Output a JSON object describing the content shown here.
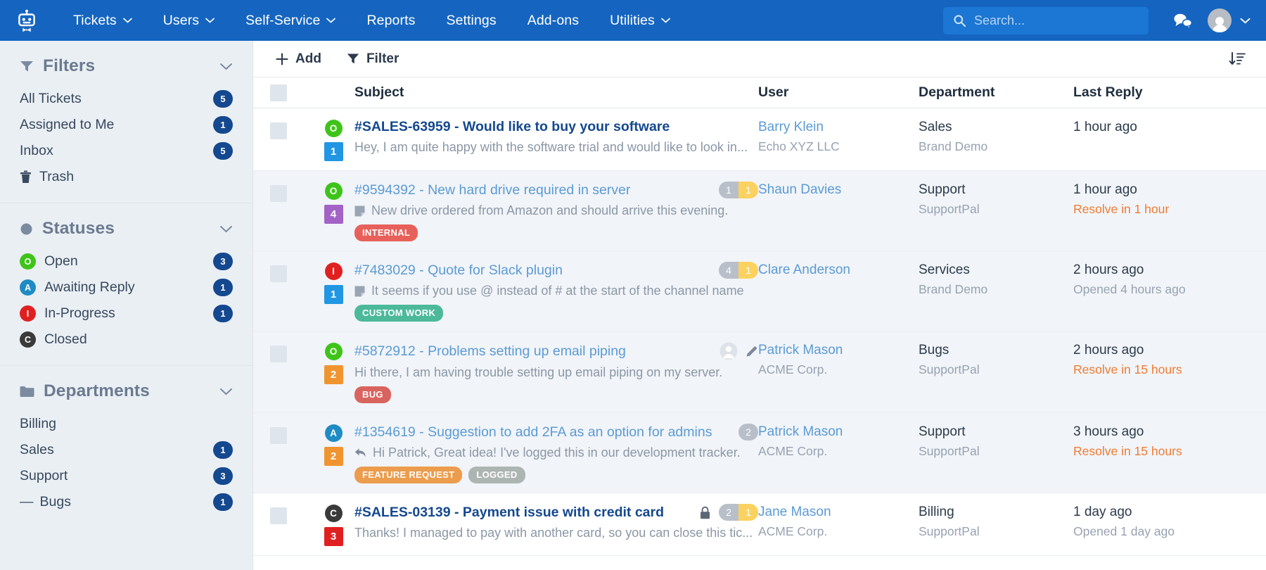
{
  "nav": {
    "logo_icon": "robot-logo-icon",
    "items": [
      {
        "label": "Tickets",
        "caret": true
      },
      {
        "label": "Users",
        "caret": true
      },
      {
        "label": "Self-Service",
        "caret": true
      },
      {
        "label": "Reports",
        "caret": false
      },
      {
        "label": "Settings",
        "caret": false
      },
      {
        "label": "Add-ons",
        "caret": false
      },
      {
        "label": "Utilities",
        "caret": true
      }
    ],
    "search": {
      "placeholder": "Search...",
      "value": "",
      "icon": "search-icon"
    },
    "chat_icon": "chat-bubbles-icon",
    "account_icon": "user-avatar-icon",
    "account_caret_icon": "chevron-down-icon"
  },
  "sidebar": {
    "sections": [
      {
        "title": "Filters",
        "icon": "funnel-icon",
        "chevron": "chevron-down-icon",
        "rows": [
          {
            "label": "All Tickets",
            "count": "5",
            "icon": "",
            "type": "plain"
          },
          {
            "label": "Assigned to Me",
            "count": "1",
            "icon": "",
            "type": "plain"
          },
          {
            "label": "Inbox",
            "count": "5",
            "icon": "",
            "type": "plain"
          },
          {
            "label": "Trash",
            "count": "",
            "icon": "trash-icon",
            "type": "icon"
          }
        ]
      },
      {
        "title": "Statuses",
        "icon": "circle-icon",
        "chevron": "chevron-down-icon",
        "rows": [
          {
            "label": "Open",
            "count": "3",
            "letter": "O",
            "color": "#3ec419",
            "type": "status"
          },
          {
            "label": "Awaiting Reply",
            "count": "1",
            "letter": "A",
            "color": "#1e8bc3",
            "type": "status"
          },
          {
            "label": "In-Progress",
            "count": "1",
            "letter": "I",
            "color": "#e02020",
            "type": "status"
          },
          {
            "label": "Closed",
            "count": "",
            "letter": "C",
            "color": "#3a3a3a",
            "type": "status"
          }
        ]
      },
      {
        "title": "Departments",
        "icon": "folder-icon",
        "chevron": "chevron-down-icon",
        "rows": [
          {
            "label": "Billing",
            "count": "",
            "type": "plain"
          },
          {
            "label": "Sales",
            "count": "1",
            "type": "plain"
          },
          {
            "label": "Support",
            "count": "3",
            "type": "plain"
          },
          {
            "label": "Bugs",
            "count": "1",
            "type": "child"
          }
        ]
      }
    ]
  },
  "toolbar": {
    "add_label": "Add",
    "add_icon": "plus-icon",
    "filter_label": "Filter",
    "filter_icon": "funnel-icon",
    "sort_icon": "sort-descending-icon"
  },
  "table": {
    "headers": {
      "subject": "Subject",
      "user": "User",
      "department": "Department",
      "last_reply": "Last Reply"
    },
    "rows": [
      {
        "status_letter": "O",
        "status_color": "#3ec419",
        "priority": "1",
        "priority_color": "#2196e3",
        "title": "#SALES-63959 - Would like to buy your software",
        "unread": true,
        "excerpt": "Hey, I am quite happy with the software trial and would like to look in...",
        "excerpt_icon": "",
        "tags": [],
        "counts": [],
        "locked": false,
        "assignee_icons": [],
        "user": "Barry Klein",
        "company": "Echo XYZ LLC",
        "department": "Sales",
        "brand": "Brand Demo",
        "last_reply": "1 hour ago",
        "sla": "",
        "sla_warn": false
      },
      {
        "status_letter": "O",
        "status_color": "#3ec419",
        "priority": "4",
        "priority_color": "#a363c6",
        "title": "#9594392 - New hard drive required in server",
        "unread": false,
        "excerpt": "New drive ordered from Amazon and should arrive this evening.",
        "excerpt_icon": "note-icon",
        "tags": [
          {
            "label": "INTERNAL",
            "color": "#e8605a"
          }
        ],
        "counts": [
          {
            "value": "1",
            "style": "grey"
          },
          {
            "value": "1",
            "style": "yellow"
          }
        ],
        "locked": false,
        "assignee_icons": [],
        "user": "Shaun Davies",
        "company": "",
        "department": "Support",
        "brand": "SupportPal",
        "last_reply": "1 hour ago",
        "sla": "Resolve in 1 hour",
        "sla_warn": true
      },
      {
        "status_letter": "I",
        "status_color": "#e02020",
        "priority": "1",
        "priority_color": "#2196e3",
        "title": "#7483029 - Quote for Slack plugin",
        "unread": false,
        "excerpt": "It seems if you use @ instead of # at the start of the channel name",
        "excerpt_icon": "note-icon",
        "tags": [
          {
            "label": "CUSTOM WORK",
            "color": "#4cb99a"
          }
        ],
        "counts": [
          {
            "value": "4",
            "style": "grey"
          },
          {
            "value": "1",
            "style": "yellow"
          }
        ],
        "locked": false,
        "assignee_icons": [],
        "user": "Clare Anderson",
        "company": "",
        "department": "Services",
        "brand": "Brand Demo",
        "last_reply": "2 hours ago",
        "sla": "Opened 4 hours ago",
        "sla_warn": false
      },
      {
        "status_letter": "O",
        "status_color": "#3ec419",
        "priority": "2",
        "priority_color": "#f0942f",
        "title": "#5872912 - Problems setting up email piping",
        "unread": false,
        "excerpt": "Hi there, I am having trouble setting up email piping on my server.",
        "excerpt_icon": "",
        "tags": [
          {
            "label": "BUG",
            "color": "#d9645f"
          }
        ],
        "counts": [],
        "locked": false,
        "assignee_icons": [
          "user-avatar-icon",
          "pencil-icon"
        ],
        "user": "Patrick Mason",
        "company": "ACME Corp.",
        "department": "Bugs",
        "brand": "SupportPal",
        "last_reply": "2 hours ago",
        "sla": "Resolve in 15 hours",
        "sla_warn": true
      },
      {
        "status_letter": "A",
        "status_color": "#1e8bc3",
        "priority": "2",
        "priority_color": "#f0942f",
        "title": "#1354619 - Suggestion to add 2FA as an option for admins",
        "unread": false,
        "excerpt": "Hi Patrick, Great idea! I've logged this in our development tracker.",
        "excerpt_icon": "reply-icon",
        "tags": [
          {
            "label": "FEATURE REQUEST",
            "color": "#eb9c4d"
          },
          {
            "label": "LOGGED",
            "color": "#adb5b2"
          }
        ],
        "counts": [
          {
            "value": "2",
            "style": "grey-round"
          }
        ],
        "locked": false,
        "assignee_icons": [],
        "user": "Patrick Mason",
        "company": "ACME Corp.",
        "department": "Support",
        "brand": "SupportPal",
        "last_reply": "3 hours ago",
        "sla": "Resolve in 15 hours",
        "sla_warn": true
      },
      {
        "status_letter": "C",
        "status_color": "#3a3a3a",
        "priority": "3",
        "priority_color": "#e02020",
        "title": "#SALES-03139 - Payment issue with credit card",
        "unread": true,
        "excerpt": "Thanks! I managed to pay with another card, so you can close this tic...",
        "excerpt_icon": "",
        "tags": [],
        "counts": [
          {
            "value": "2",
            "style": "grey"
          },
          {
            "value": "1",
            "style": "yellow"
          }
        ],
        "locked": true,
        "assignee_icons": [],
        "user": "Jane Mason",
        "company": "ACME Corp.",
        "department": "Billing",
        "brand": "SupportPal",
        "last_reply": "1 day ago",
        "sla": "Opened 1 day ago",
        "sla_warn": false
      }
    ]
  },
  "colors": {
    "navbar": "#1565c0",
    "sidebar": "#eaeff4",
    "badge": "#14488f",
    "warn": "#ee7c33",
    "link": "#5b9bd5"
  }
}
